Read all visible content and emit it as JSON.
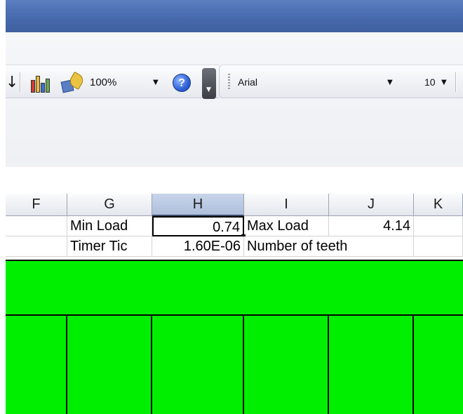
{
  "toolbar": {
    "zoom_value": "100%",
    "font_name": "Arial",
    "font_size": "10",
    "icons": [
      "sort-arrow-icon",
      "chart-wizard-icon",
      "drawing-icon",
      "help-icon",
      "toolbar-options-icon"
    ]
  },
  "sheet": {
    "column_headers": [
      "F",
      "G",
      "H",
      "I",
      "J",
      "K"
    ],
    "active_column": "H",
    "rows": [
      {
        "G": "Min Load",
        "H": "0.74",
        "I": "Max Load",
        "J": "4.14"
      },
      {
        "G": "Timer Tic",
        "H": "1.60E-06",
        "I": "Number of teeth",
        "J": ""
      }
    ],
    "fill_color": "#00ee00"
  }
}
